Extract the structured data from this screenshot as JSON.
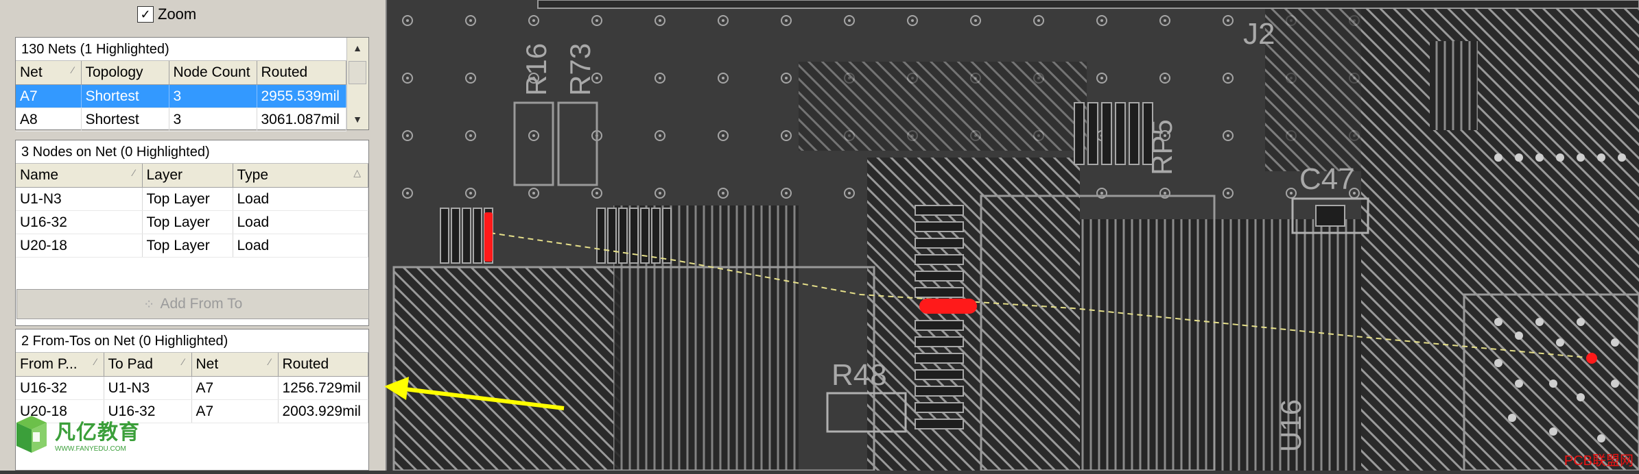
{
  "zoom": {
    "label": "Zoom",
    "checked": true
  },
  "nets": {
    "title": "130 Nets (1 Highlighted)",
    "columns": [
      "Net",
      "Topology",
      "Node Count",
      "Routed"
    ],
    "rows": [
      [
        "A7",
        "Shortest",
        "3",
        "2955.539mil"
      ],
      [
        "A8",
        "Shortest",
        "3",
        "3061.087mil"
      ]
    ],
    "selected_row": 0
  },
  "nodes": {
    "title": "3 Nodes on Net (0 Highlighted)",
    "columns": [
      "Name",
      "Layer",
      "Type"
    ],
    "rows": [
      [
        "U1-N3",
        "Top Layer",
        "Load"
      ],
      [
        "U16-32",
        "Top Layer",
        "Load"
      ],
      [
        "U20-18",
        "Top Layer",
        "Load"
      ]
    ]
  },
  "add_from_to": {
    "label": "Add From To"
  },
  "fromtos": {
    "title": "2 From-Tos on Net (0 Highlighted)",
    "columns": [
      "From P...",
      "To Pad",
      "Net",
      "Routed"
    ],
    "rows": [
      [
        "U16-32",
        "U1-N3",
        "A7",
        "1256.729mil"
      ],
      [
        "U20-18",
        "U16-32",
        "A7",
        "2003.929mil"
      ]
    ]
  },
  "logo": {
    "name": "凡亿教育",
    "url": "WWW.FANYEDU.COM"
  },
  "pcb": {
    "designators": [
      "J2",
      "R16",
      "R73",
      "RP5",
      "C47",
      "R48",
      "U16"
    ],
    "watermark": "PCB联盟网"
  },
  "colors": {
    "accent_yellow": "#ffff00",
    "highlight_red": "#ff1a1a",
    "selection_blue": "#3399ff",
    "board_bg": "#3a3a3a"
  },
  "icons": [
    "checkbox-icon",
    "scroll-up-icon",
    "scroll-down-icon",
    "sort-arrow-icon",
    "add-from-to-icon",
    "logo-cube-icon"
  ]
}
